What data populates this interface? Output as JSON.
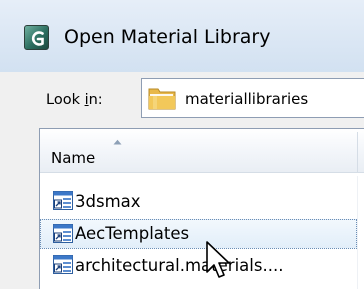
{
  "window": {
    "title": "Open Material Library",
    "app_icon": "3ds-max-app-icon"
  },
  "lookin": {
    "label": "Look in:",
    "value": "materiallibraries",
    "icon": "folder-icon"
  },
  "list": {
    "columns": [
      {
        "label": "Name",
        "sorted": "ascending"
      }
    ],
    "items": [
      {
        "label": "3dsmax",
        "icon": "shortcut-icon",
        "selected": false
      },
      {
        "label": "AecTemplates",
        "icon": "shortcut-icon",
        "selected": true
      },
      {
        "label": "architectural.materials....",
        "icon": "shortcut-icon",
        "selected": false
      }
    ]
  },
  "pointer": "mouse-cursor"
}
